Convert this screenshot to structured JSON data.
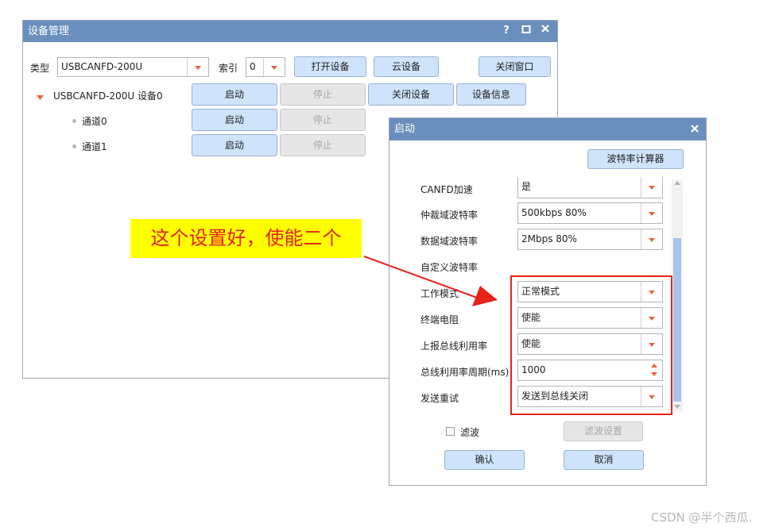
{
  "device_window": {
    "title": "设备管理",
    "help_label": "?",
    "type_label": "类型",
    "type_value": "USBCANFD-200U",
    "index_label": "索引",
    "index_value": "0",
    "open_device": "打开设备",
    "cloud_device": "云设备",
    "close_window": "关闭窗口",
    "device_node": "USBCANFD-200U 设备0",
    "channels": [
      "通道0",
      "通道1"
    ],
    "start": "启动",
    "stop": "停止",
    "close_device": "关闭设备",
    "device_info": "设备信息"
  },
  "start_dialog": {
    "title": "启动",
    "baud_calc": "波特率计算器",
    "fields": [
      {
        "label": "CANFD加速",
        "value": "是"
      },
      {
        "label": "仲裁域波特率",
        "value": "500kbps 80%"
      },
      {
        "label": "数据域波特率",
        "value": "2Mbps 80%"
      },
      {
        "label": "自定义波特率",
        "value": ""
      },
      {
        "label": "工作模式",
        "value": "正常模式"
      },
      {
        "label": "终端电阻",
        "value": "使能"
      },
      {
        "label": "上报总线利用率",
        "value": "使能"
      },
      {
        "label": "总线利用率周期(ms)",
        "value": "1000"
      },
      {
        "label": "发送重试",
        "value": "发送到总线关闭"
      }
    ],
    "filter_label": "滤波",
    "filter_settings": "滤波设置",
    "ok": "确认",
    "cancel": "取消"
  },
  "annotation": {
    "text": "这个设置好，使能二个",
    "color": "#e8211b",
    "highlight": "#ffff00"
  },
  "watermark": "CSDN @半个西瓜."
}
